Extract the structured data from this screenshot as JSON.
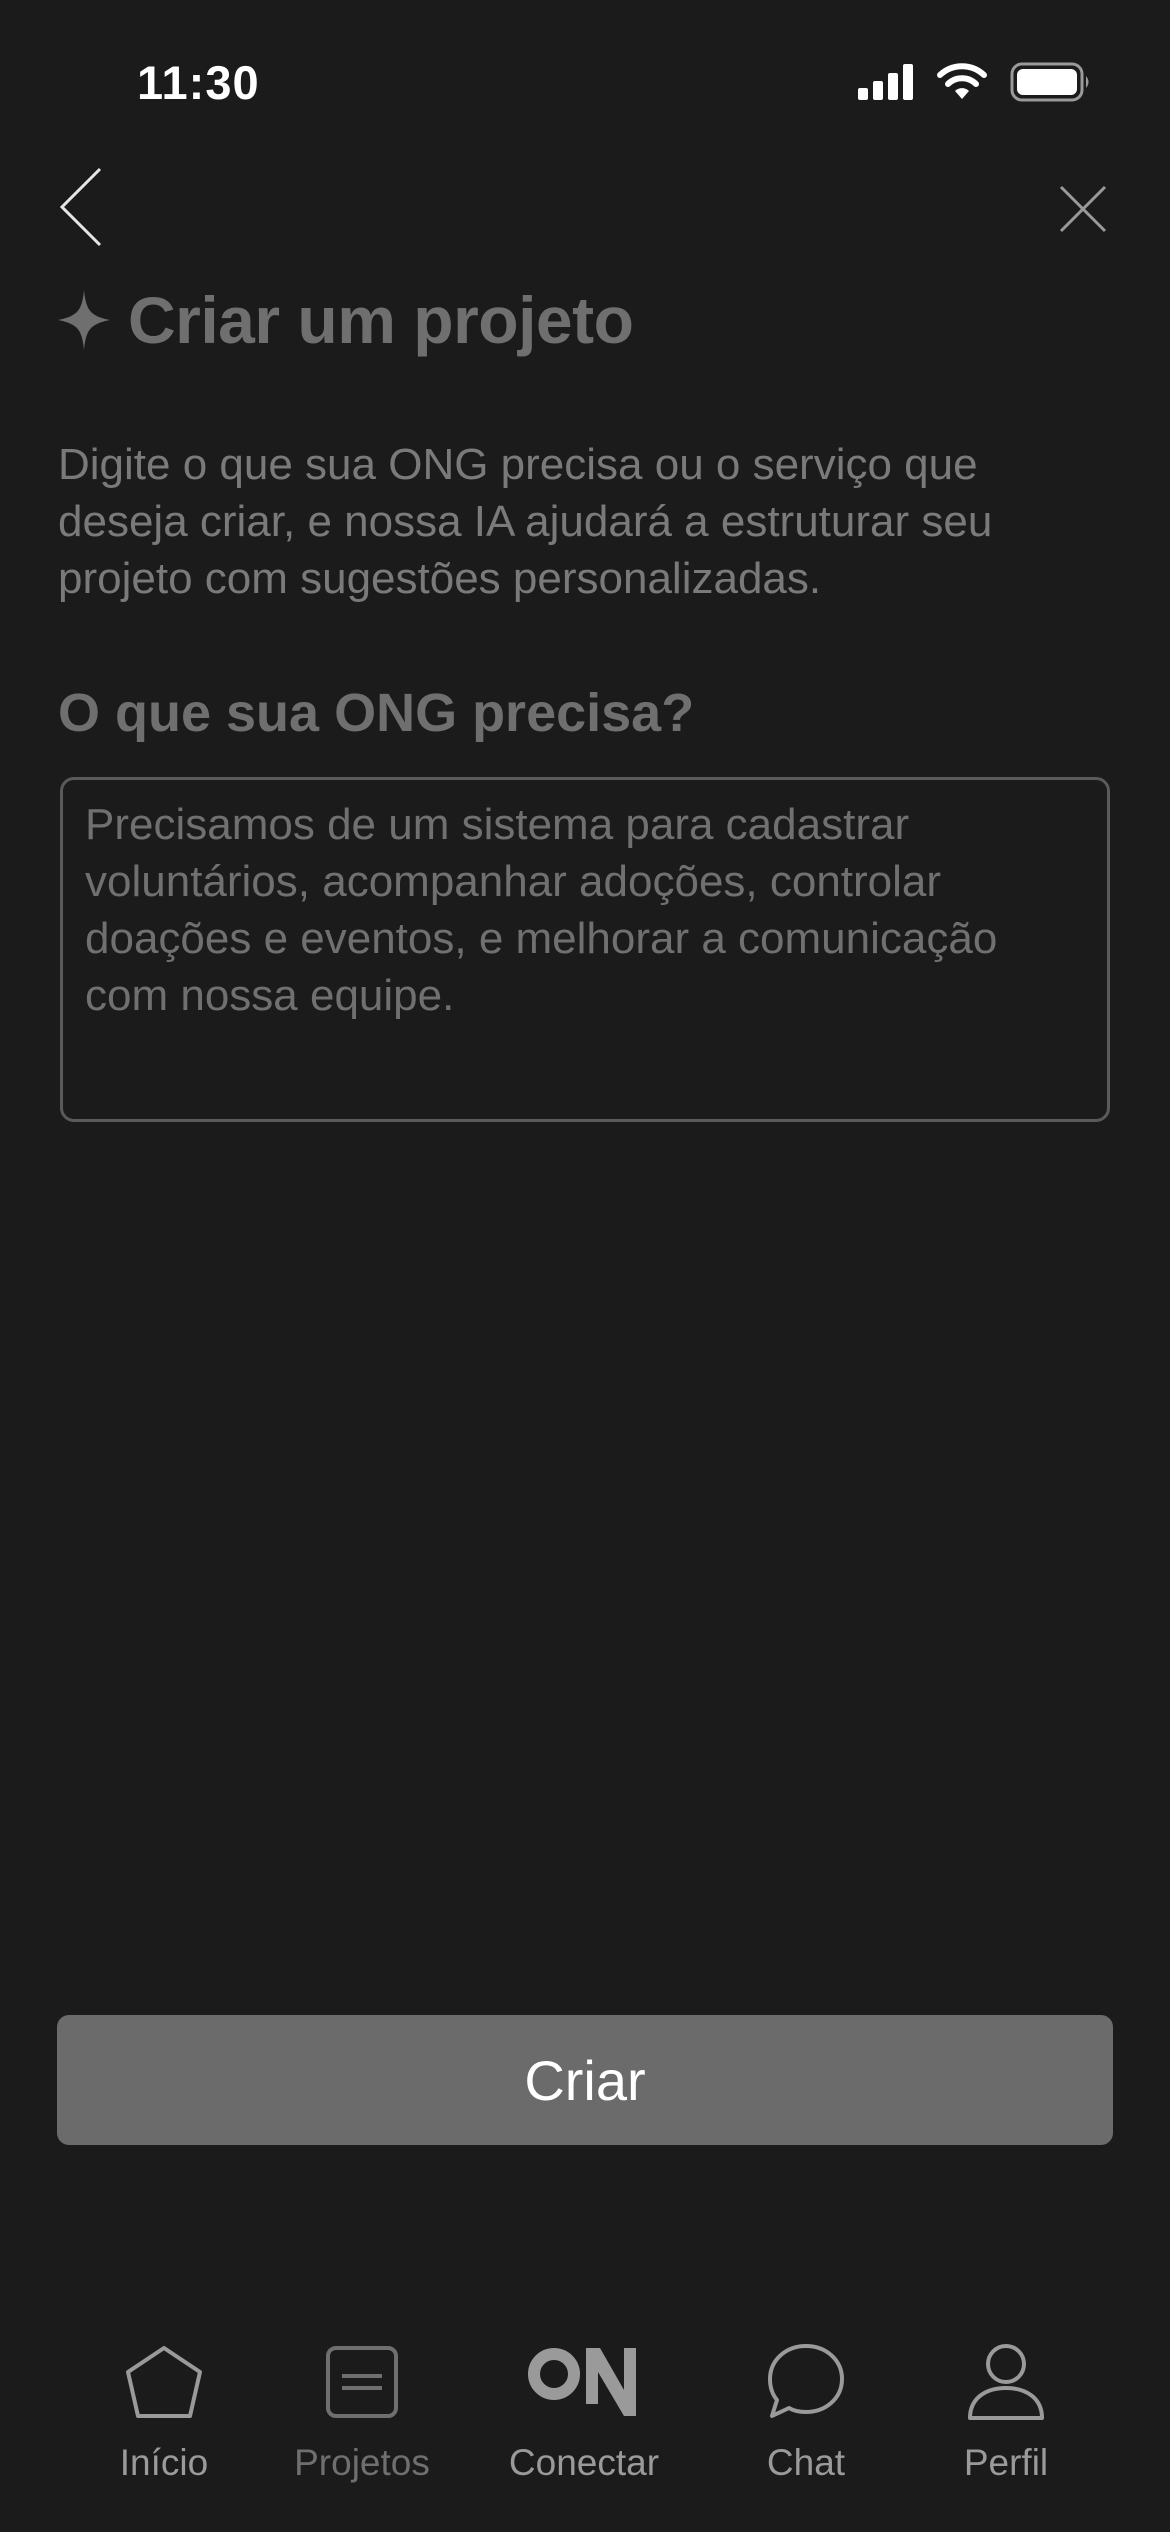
{
  "status_bar": {
    "time": "11:30"
  },
  "header": {
    "title": "Criar um projeto",
    "description": "Digite o que sua ONG precisa ou o serviço que deseja criar, e nossa IA ajudará a estruturar seu projeto com sugestões personalizadas."
  },
  "form": {
    "question_label": "O que sua ONG precisa?",
    "input_value": "",
    "input_placeholder": "Precisamos de um sistema para cadastrar voluntários, acompanhar adoções, controlar doações e eventos, e melhorar a comunicação com nossa equipe."
  },
  "actions": {
    "create_label": "Criar"
  },
  "tab_bar": {
    "tabs": [
      {
        "label": "Início",
        "icon": "home-pentagon-icon"
      },
      {
        "label": "Projetos",
        "icon": "document-list-icon"
      },
      {
        "label": "Conectar",
        "icon": "on-logo-icon"
      },
      {
        "label": "Chat",
        "icon": "chat-bubble-icon"
      },
      {
        "label": "Perfil",
        "icon": "user-icon"
      }
    ],
    "active_index": 1
  },
  "colors": {
    "background": "#1b1b1b",
    "button": "#6b6b6b",
    "muted_text": "#6f6f6f"
  }
}
